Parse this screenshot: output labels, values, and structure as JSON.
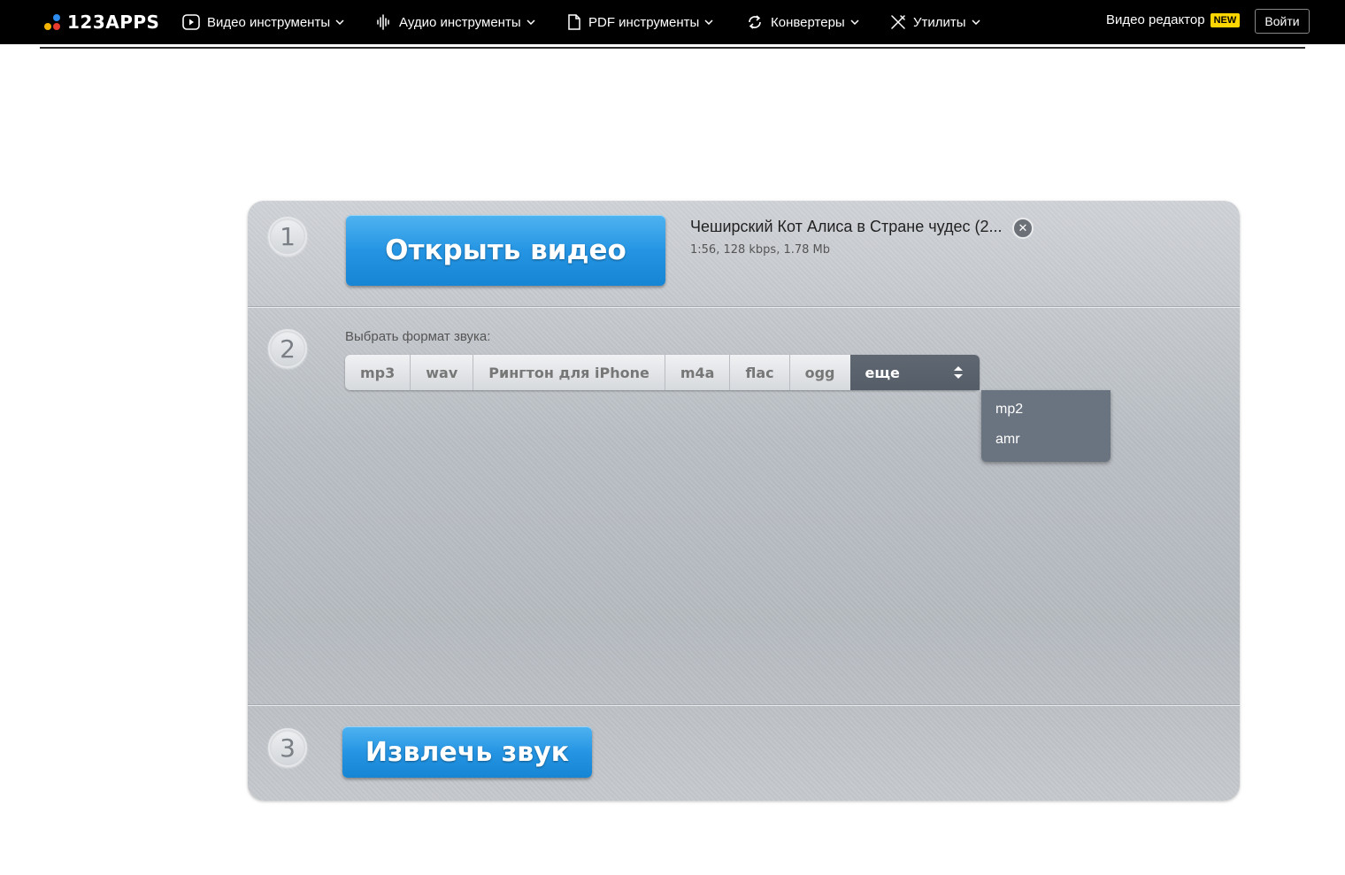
{
  "brand": {
    "logo_text": "123APPS"
  },
  "nav": {
    "items": [
      {
        "label": "Видео инструменты",
        "icon": "play-circle-icon"
      },
      {
        "label": "Аудио инструменты",
        "icon": "waveform-icon"
      },
      {
        "label": "PDF инструменты",
        "icon": "document-icon"
      },
      {
        "label": "Конвертеры",
        "icon": "convert-arrows-icon"
      },
      {
        "label": "Утилиты",
        "icon": "tools-icon"
      }
    ],
    "editor_label": "Видео редактор",
    "new_badge": "NEW",
    "login_label": "Войти"
  },
  "step1": {
    "number": "1",
    "button_label": "Открыть видео",
    "file_name": "Чеширский Кот Алиса в Стране чудес (2...",
    "file_meta": "1:56, 128 kbps, 1.78 Mb"
  },
  "step2": {
    "number": "2",
    "label": "Выбрать формат звука:",
    "formats": [
      "mp3",
      "wav",
      "Рингтон для iPhone",
      "m4a",
      "flac",
      "ogg"
    ],
    "more_label": "еще",
    "more_options": [
      "mp2",
      "amr"
    ]
  },
  "step3": {
    "number": "3",
    "button_label": "Извлечь звук"
  },
  "colors": {
    "topbar": "#000000",
    "accent_blue": "#2595e3",
    "badge_yellow": "#ffd600",
    "dropdown_bg": "#6a7380"
  }
}
